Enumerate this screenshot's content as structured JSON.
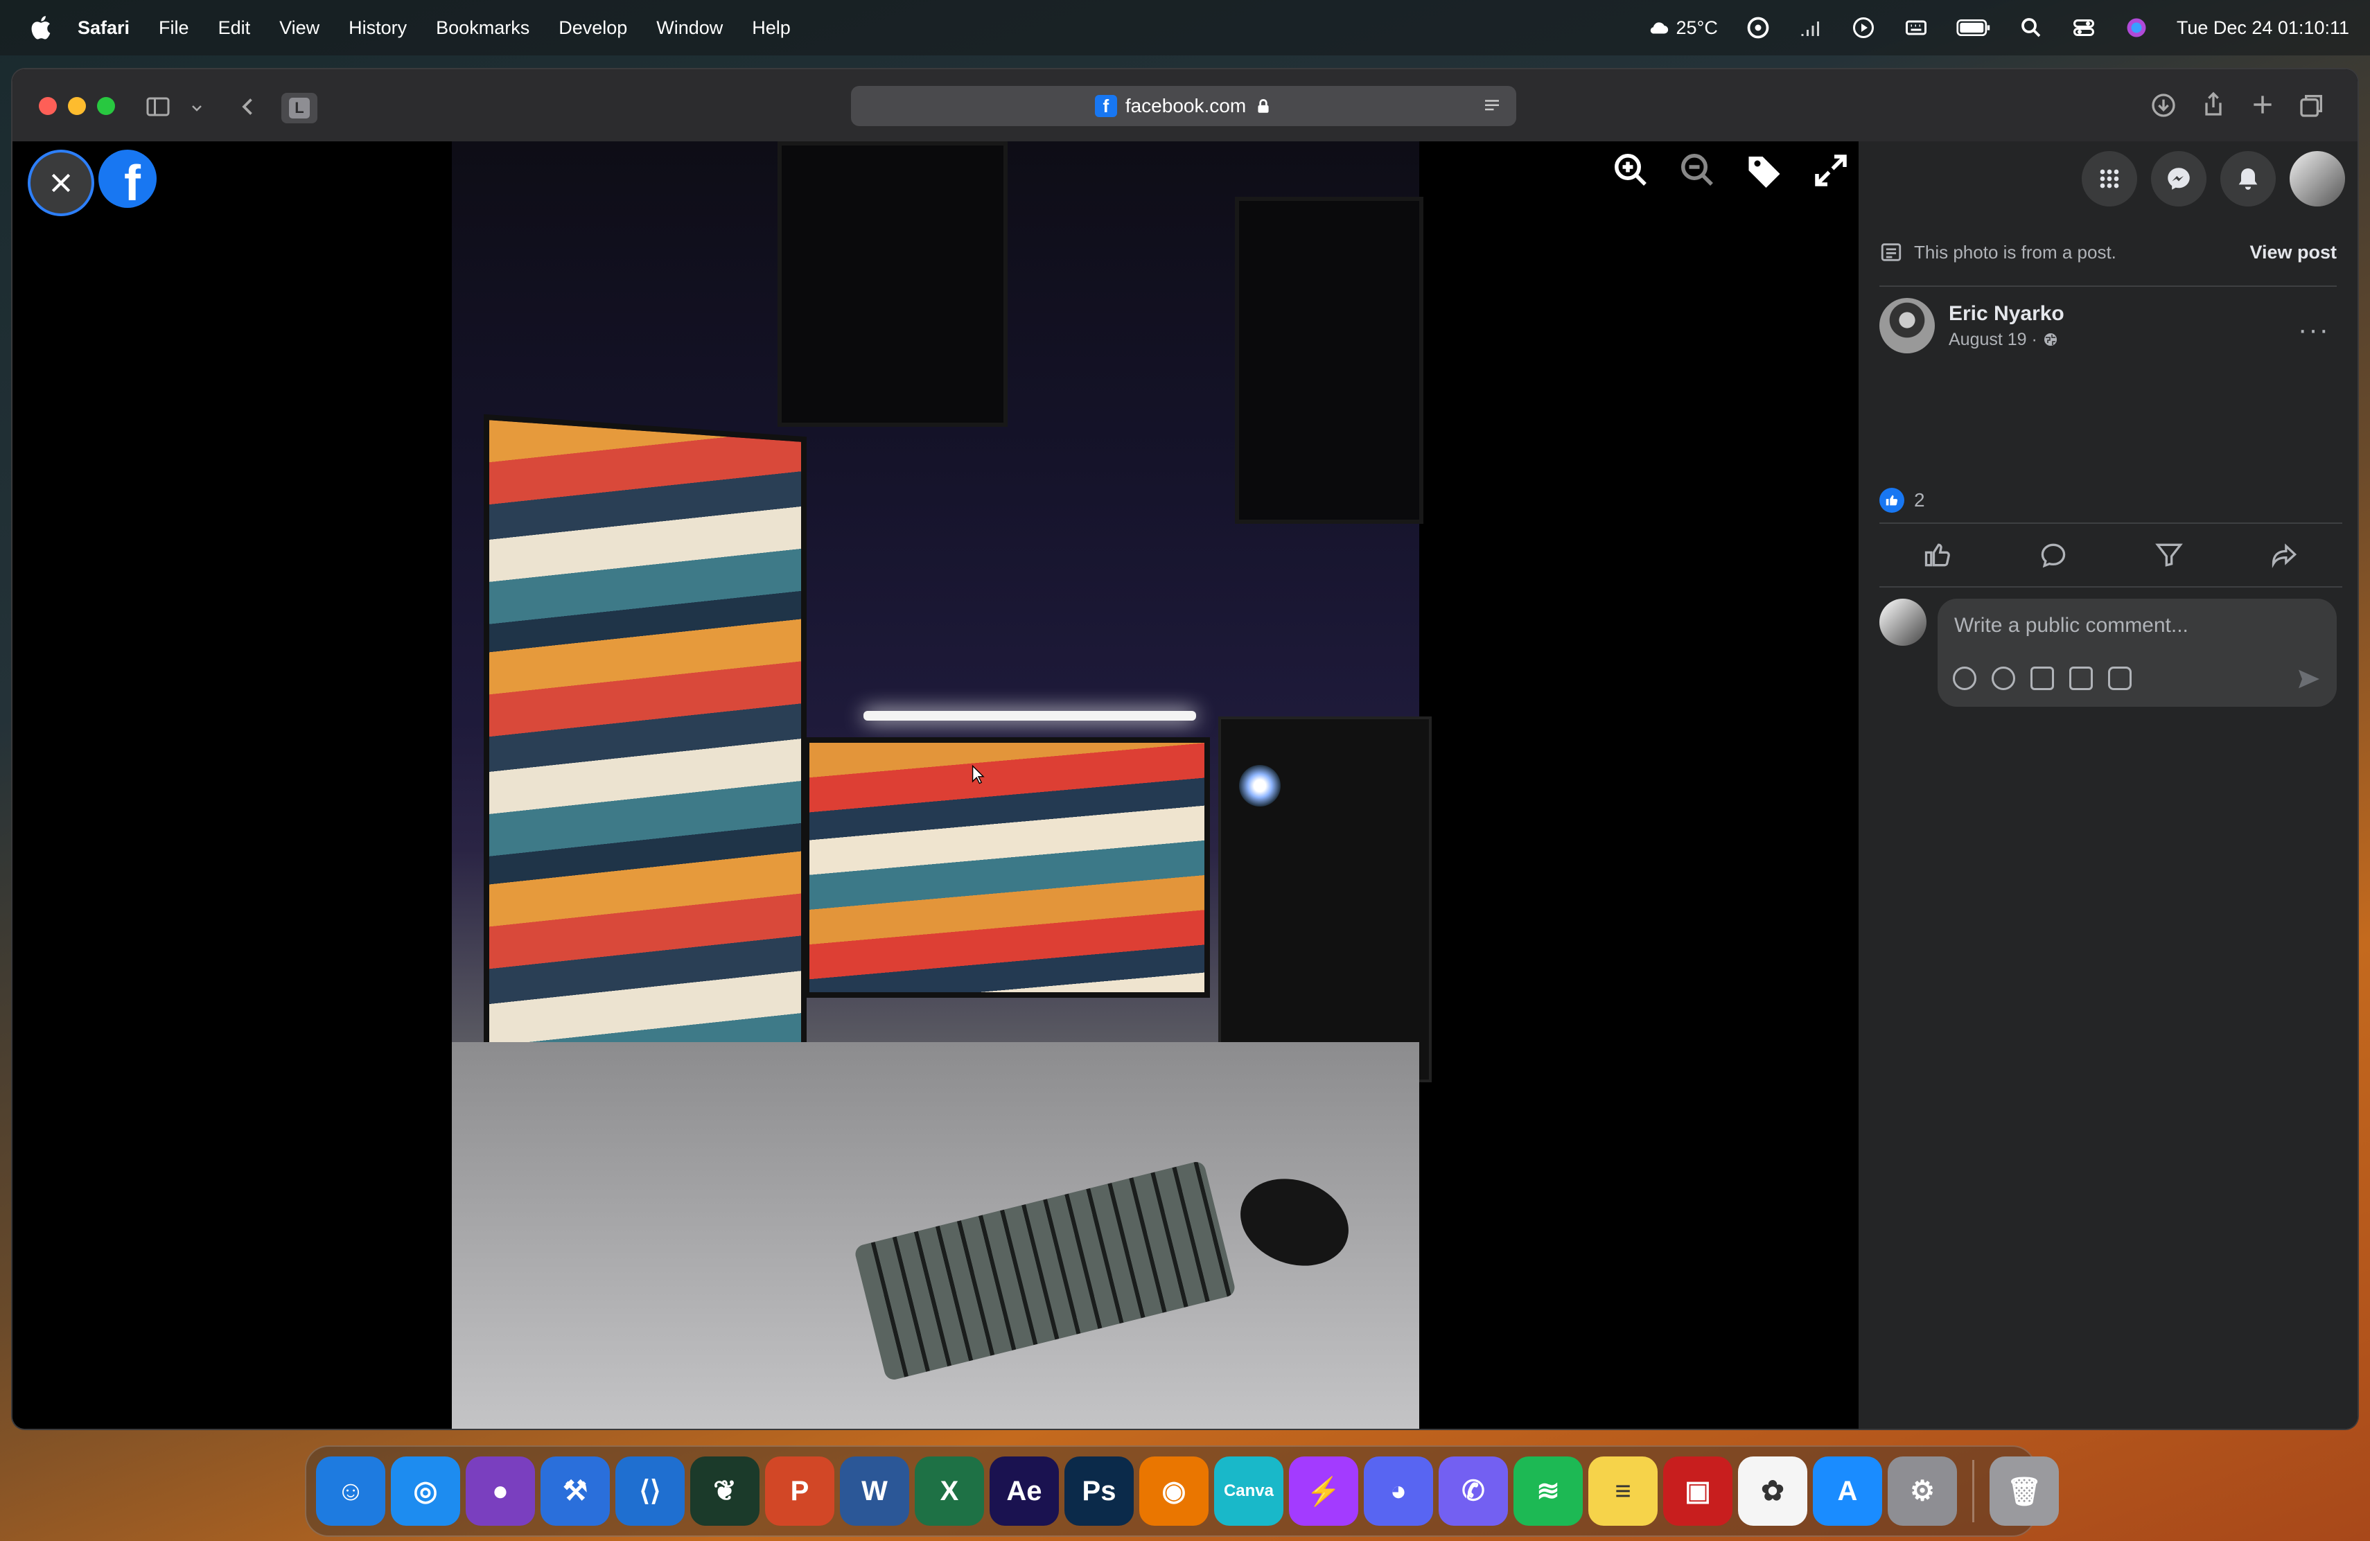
{
  "menubar": {
    "app": "Safari",
    "items": [
      "File",
      "Edit",
      "View",
      "History",
      "Bookmarks",
      "Develop",
      "Window",
      "Help"
    ],
    "weather": "25°C",
    "datetime": "Tue Dec 24  01:10:11"
  },
  "browser": {
    "url": "facebook.com",
    "tab_letter": "L"
  },
  "photo_viewer": {
    "close_label": "Close",
    "fb_letter": "f"
  },
  "sidebar": {
    "from_post_text": "This photo is from a post.",
    "view_post_label": "View post",
    "author_name": "Eric Nyarko",
    "post_date": "August 19 · ",
    "more_label": "···",
    "like_count": "2",
    "comment_placeholder": "Write a public comment..."
  },
  "dock": {
    "apps": [
      {
        "name": "Finder",
        "color": "#1e7be0",
        "glyph": "☺"
      },
      {
        "name": "Safari",
        "color": "#1d8cf0",
        "glyph": "◎"
      },
      {
        "name": "GitHub Desktop",
        "color": "#7a3fbf",
        "glyph": "●"
      },
      {
        "name": "Xcode",
        "color": "#2a6fdb",
        "glyph": "⚒"
      },
      {
        "name": "VS Code",
        "color": "#1f6fd0",
        "glyph": "⟨⟩"
      },
      {
        "name": "MongoDB",
        "color": "#1b3a2a",
        "glyph": "❦"
      },
      {
        "name": "PowerPoint",
        "color": "#d24726",
        "glyph": "P"
      },
      {
        "name": "Word",
        "color": "#2b5797",
        "glyph": "W"
      },
      {
        "name": "Excel",
        "color": "#1e7145",
        "glyph": "X"
      },
      {
        "name": "After Effects",
        "color": "#1a1250",
        "glyph": "Ae"
      },
      {
        "name": "Photoshop",
        "color": "#0b2a4a",
        "glyph": "Ps"
      },
      {
        "name": "Blender",
        "color": "#ea7600",
        "glyph": "◉"
      },
      {
        "name": "Canva",
        "color": "#19b8c9",
        "glyph": "Canva"
      },
      {
        "name": "Messenger",
        "color": "#a33bff",
        "glyph": "⚡"
      },
      {
        "name": "Discord",
        "color": "#5865f2",
        "glyph": "◕"
      },
      {
        "name": "Viber",
        "color": "#7360f2",
        "glyph": "✆"
      },
      {
        "name": "Spotify",
        "color": "#1db954",
        "glyph": "≋"
      },
      {
        "name": "Notes",
        "color": "#f6d34a",
        "glyph": "≡"
      },
      {
        "name": "Photo Booth",
        "color": "#c81e1e",
        "glyph": "▣"
      },
      {
        "name": "Photos",
        "color": "#f5f5f5",
        "glyph": "✿"
      },
      {
        "name": "App Store",
        "color": "#1a8cff",
        "glyph": "A"
      },
      {
        "name": "System Settings",
        "color": "#8e8e93",
        "glyph": "⚙"
      }
    ],
    "trash": {
      "name": "Trash",
      "color": "#9a9a9e",
      "glyph": "🗑"
    }
  },
  "colors": {
    "fb_blue": "#1877f2",
    "panel": "#242526",
    "panel_input": "#3a3b3c"
  }
}
